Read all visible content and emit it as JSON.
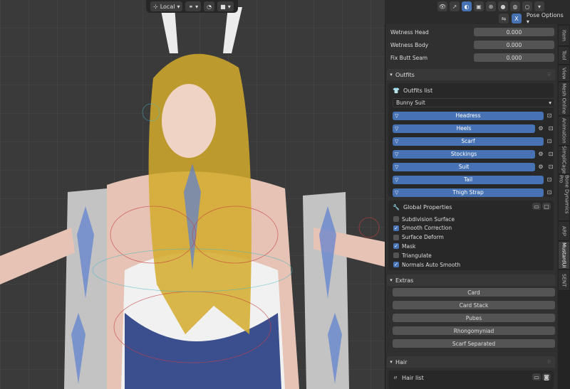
{
  "toolbar": {
    "transform_orientation": "Local",
    "orientation_icon": "axes-icon",
    "snap_icon": "magnet-icon",
    "proportional_icon": "circle-icon"
  },
  "header": {
    "pose_options_label": "Pose Options",
    "close_label": "X"
  },
  "tabs": [
    "Item",
    "Tool",
    "View",
    "Mesh Online",
    "Animation",
    "SimpliCage",
    "Bone Dynamics Pro",
    "ARP",
    "MustardUI",
    "SENT"
  ],
  "active_tab": "MustardUI",
  "wetness": [
    {
      "label": "Wetness Head",
      "value": "0.000"
    },
    {
      "label": "Wetness Body",
      "value": "0.000"
    },
    {
      "label": "Fix Butt Seam",
      "value": "0.000"
    }
  ],
  "outfits": {
    "title": "Outfits",
    "list_label": "Outfits list",
    "selected": "Bunny Suit",
    "items": [
      {
        "label": "Headress",
        "gear": false
      },
      {
        "label": "Heels",
        "gear": true
      },
      {
        "label": "Scarf",
        "gear": false
      },
      {
        "label": "Stockings",
        "gear": true
      },
      {
        "label": "Suit",
        "gear": true
      },
      {
        "label": "Tail",
        "gear": false
      },
      {
        "label": "Thigh Strap",
        "gear": false
      }
    ]
  },
  "global_properties": {
    "title": "Global Properties",
    "options": [
      {
        "label": "Subdivision Surface",
        "checked": false
      },
      {
        "label": "Smooth Correction",
        "checked": true
      },
      {
        "label": "Surface Deform",
        "checked": false
      },
      {
        "label": "Mask",
        "checked": true
      },
      {
        "label": "Triangulate",
        "checked": false
      },
      {
        "label": "Normals Auto Smooth",
        "checked": true
      }
    ]
  },
  "extras": {
    "title": "Extras",
    "items": [
      "Card",
      "Card Stack",
      "Pubes",
      "Rhongomyniad",
      "Scarf Separated"
    ]
  },
  "hair": {
    "title": "Hair",
    "list_label": "Hair list"
  },
  "colors": {
    "accent": "#4772b3",
    "panel": "#303030",
    "field": "#545454"
  }
}
